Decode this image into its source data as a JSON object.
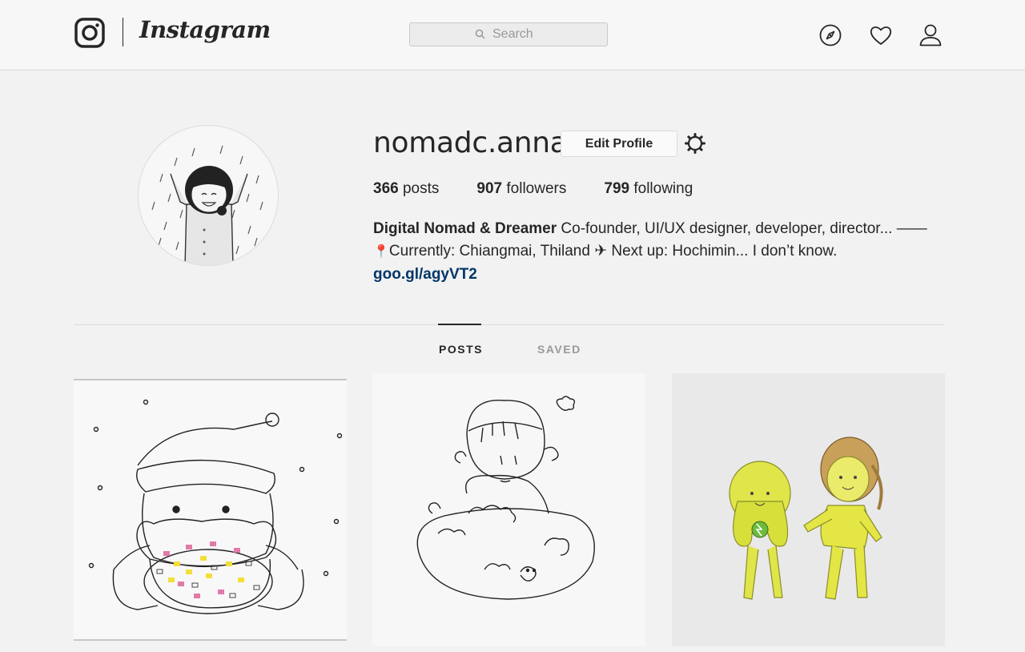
{
  "header": {
    "brand": "Instagram",
    "search": {
      "placeholder": "Search"
    },
    "nav_icons": [
      "explore-icon",
      "heart-icon",
      "profile-icon"
    ]
  },
  "profile": {
    "username": "nomadc.anna",
    "edit_label": "Edit Profile",
    "stats": {
      "posts_count": "366",
      "posts_label": "posts",
      "followers_count": "907",
      "followers_label": "followers",
      "following_count": "799",
      "following_label": "following"
    },
    "bio": {
      "name": "Digital Nomad & Dreamer",
      "line1_rest": "Co-founder, UI/UX designer, developer, director... ——",
      "line2": "Currently: Chiangmai, Thiland ✈ Next up: Hochimin... I don’t know.",
      "pin_glyph": "📍",
      "link": "goo.gl/agyVT2"
    }
  },
  "tabs": {
    "posts": "POSTS",
    "saved": "SAVED"
  },
  "colors": {
    "background": "#f2f2f2",
    "link": "#003569",
    "border": "#dbdbdb"
  }
}
